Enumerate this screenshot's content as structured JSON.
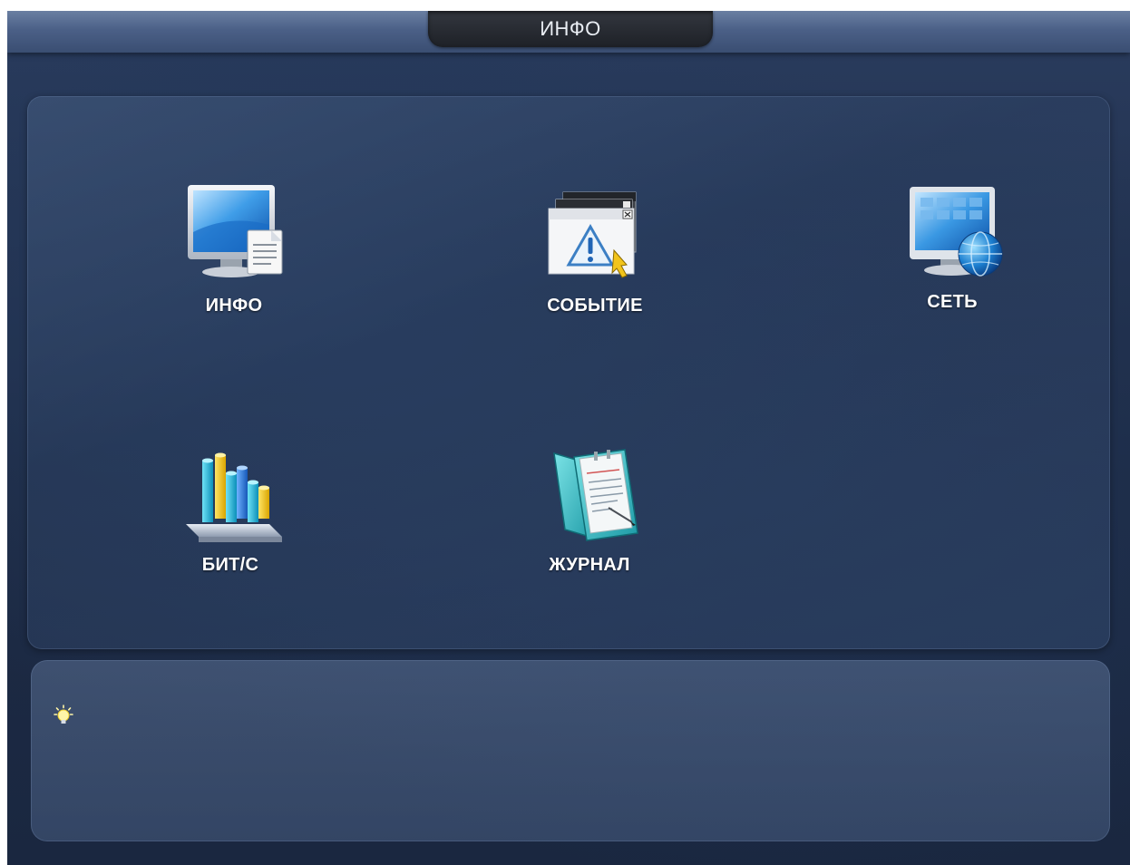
{
  "header": {
    "title": "ИНФО"
  },
  "menu": {
    "items": [
      {
        "label": "ИНФО",
        "icon": "monitor-document-icon"
      },
      {
        "label": "СОБЫТИЕ",
        "icon": "warning-window-icon"
      },
      {
        "label": "СЕТЬ",
        "icon": "monitor-globe-icon"
      },
      {
        "label": "БИТ/С",
        "icon": "bar-chart-icon"
      },
      {
        "label": "ЖУРНАЛ",
        "icon": "log-book-icon"
      }
    ]
  },
  "hint": {
    "icon": "lightbulb-icon",
    "text": ""
  },
  "colors": {
    "background": "#1f2e4a",
    "title_tab": "#25282e",
    "title_strip": "#4b6087",
    "label_text": "#ffffff"
  }
}
